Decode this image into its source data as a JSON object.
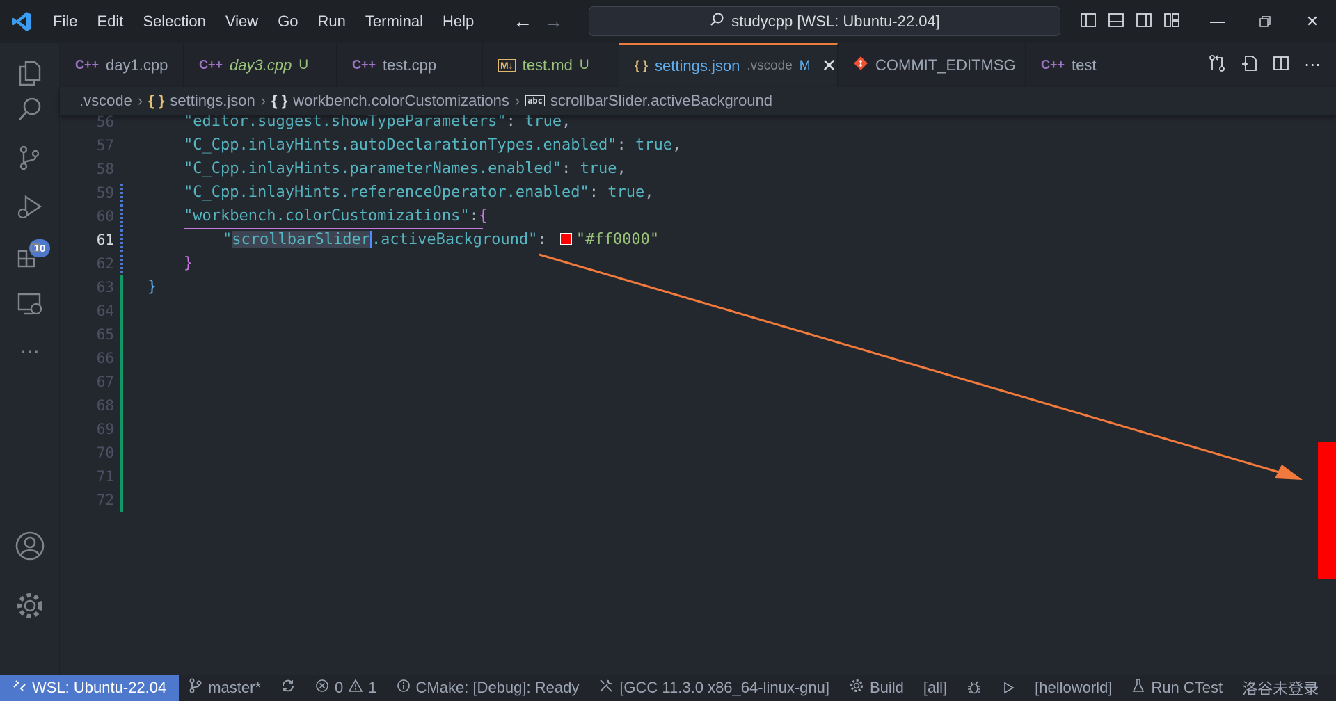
{
  "menu": [
    "File",
    "Edit",
    "Selection",
    "View",
    "Go",
    "Run",
    "Terminal",
    "Help"
  ],
  "command_center": {
    "label": "studycpp [WSL: Ubuntu-22.04]"
  },
  "tabs": [
    {
      "label": "day1.cpp",
      "kind": "cpp",
      "status": ""
    },
    {
      "label": "day3.cpp",
      "kind": "cpp",
      "status": "U"
    },
    {
      "label": "test.cpp",
      "kind": "cpp",
      "status": ""
    },
    {
      "label": "test.md",
      "kind": "md",
      "status": "U",
      "icon_text": "M↓"
    },
    {
      "label": "settings.json",
      "kind": "json",
      "dir": ".vscode",
      "status": "M",
      "active": true,
      "icon_text": "{ }"
    },
    {
      "label": "COMMIT_EDITMSG",
      "kind": "git",
      "status": ""
    },
    {
      "label": "test",
      "kind": "cpp",
      "status": ""
    }
  ],
  "icons": {
    "cpp_tab": "C++"
  },
  "breadcrumb": {
    "folder": ".vscode",
    "file": "settings.json",
    "object": "workbench.colorCustomizations",
    "property": "scrollbarSlider.activeBackground",
    "json_icon": "{ }",
    "object_icon": "{ }",
    "string_icon": "abc"
  },
  "editor": {
    "line_numbers": [
      "56",
      "57",
      "58",
      "59",
      "60",
      "61",
      "62",
      "63",
      "64",
      "65",
      "66",
      "67",
      "68",
      "69",
      "70",
      "71",
      "72"
    ],
    "current_line": "61",
    "lines": {
      "l56": {
        "key": "\"editor.suggest.showTypeParameters\"",
        "sep": ": ",
        "value": "true",
        "end": ","
      },
      "l57": {
        "key": "\"C_Cpp.inlayHints.autoDeclarationTypes.enabled\"",
        "sep": ": ",
        "value": "true",
        "end": ","
      },
      "l58": {
        "key": "\"C_Cpp.inlayHints.parameterNames.enabled\"",
        "sep": ": ",
        "value": "true",
        "end": ","
      },
      "l59": {
        "key": "\"C_Cpp.inlayHints.referenceOperator.enabled\"",
        "sep": ": ",
        "value": "true",
        "end": ","
      },
      "l60": {
        "key": "\"workbench.colorCustomizations\"",
        "sep": ":",
        "brace": "{"
      },
      "l61": {
        "quote": "\"",
        "key_selected": "scrollbarSlider",
        "key_rest": ".activeBackground\"",
        "sep": ": ",
        "value": "\"#ff0000\""
      },
      "l62": {
        "brace": "}"
      },
      "l63": {
        "brace": "}"
      }
    }
  },
  "colors": {
    "accent": "#4d78cc",
    "slider": "#ff0000",
    "arrow": "#f27a3c",
    "tab_active_border": "#e87d3e"
  },
  "statusbar": {
    "remote": "WSL: Ubuntu-22.04",
    "branch": "master*",
    "errors": "0",
    "warnings": "1",
    "cmake": "CMake: [Debug]: Ready",
    "kit": "[GCC 11.3.0 x86_64-linux-gnu]",
    "build": "Build",
    "target": "[all]",
    "launch_target": "[helloworld]",
    "ctest": "Run CTest",
    "account": "洛谷未登录"
  }
}
